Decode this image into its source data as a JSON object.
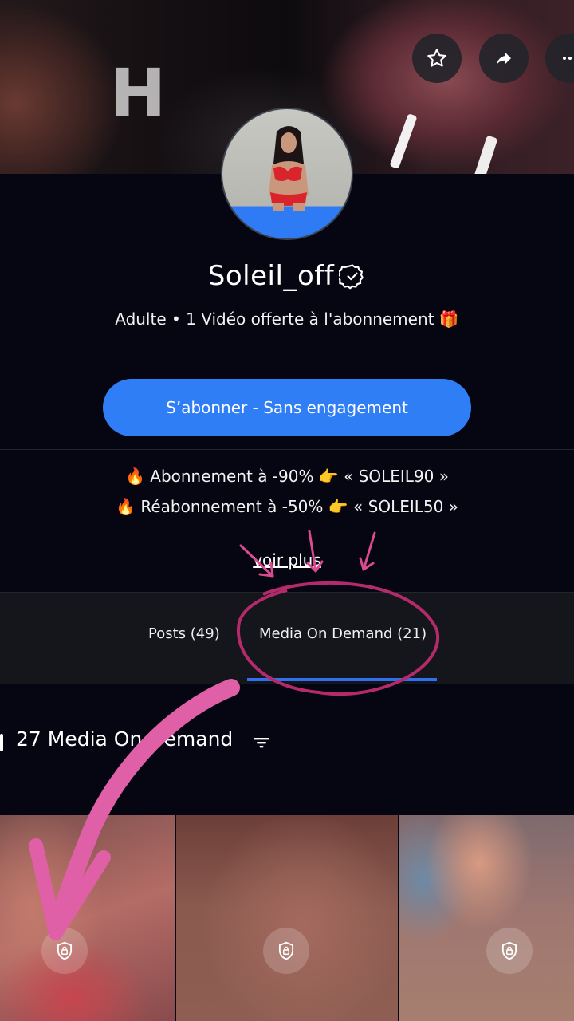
{
  "banner": {
    "letter": "H",
    "actions": {
      "favorite_icon": "star-icon",
      "share_icon": "share-arrow-icon",
      "more_icon": "more-dots-icon"
    }
  },
  "profile": {
    "name": "Soleil_off",
    "verified_icon": "verified-badge-icon",
    "subtitle": "Adulte • 1 Vidéo offerte à l'abonnement 🎁"
  },
  "subscribe_button": {
    "label": "S’abonner - Sans engagement"
  },
  "promos": [
    "🔥 Abonnement à -90% 👉 « SOLEIL90 »",
    "🔥 Réabonnement à -50% 👉 « SOLEIL50 »"
  ],
  "voir_plus": "voir plus",
  "tabs": [
    {
      "label": "Posts (49)",
      "active": false
    },
    {
      "label": "Media On Demand (21)",
      "active": true
    }
  ],
  "media": {
    "count_label": "27 Media On Demand",
    "filter_icon": "filter-icon",
    "thumbnails": [
      {
        "locked": true,
        "lock_icon": "lock-shield-icon"
      },
      {
        "locked": true,
        "lock_icon": "lock-shield-icon"
      },
      {
        "locked": true,
        "lock_icon": "lock-shield-icon"
      }
    ]
  },
  "colors": {
    "accent": "#2f7ef6",
    "background": "#050611",
    "annotation": "#d94a8f"
  }
}
